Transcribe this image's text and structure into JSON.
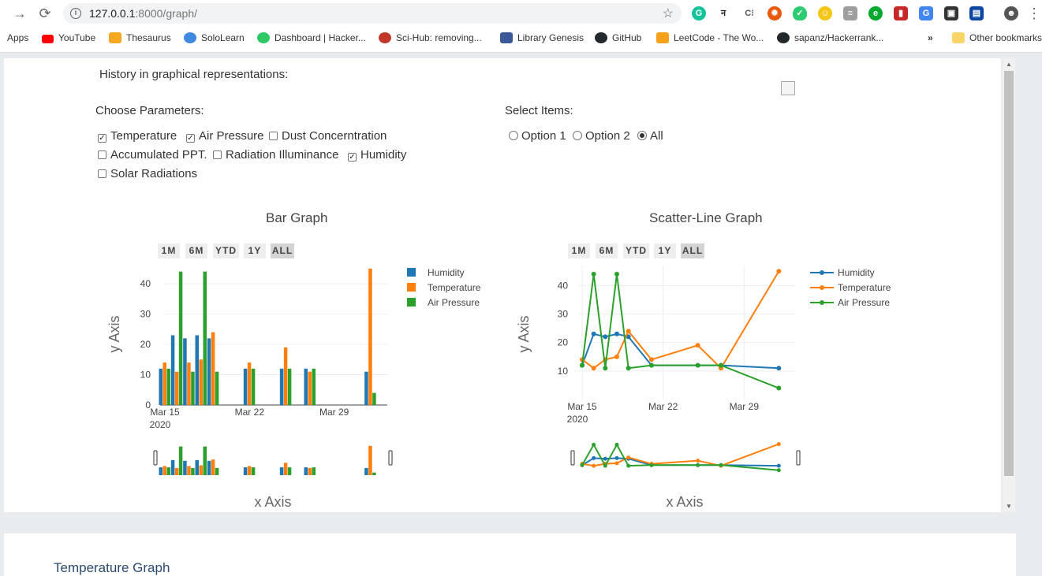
{
  "browser": {
    "url_host": "127.0.0.1",
    "url_path": ":8000/graph/",
    "bookmarks": [
      {
        "label": "Apps",
        "color": "#4285f4"
      },
      {
        "label": "YouTube",
        "color": "#ff0000"
      },
      {
        "label": "Thesaurus",
        "color": "#f6a821"
      },
      {
        "label": "SoloLearn",
        "color": "#3f8ae0"
      },
      {
        "label": "Dashboard | Hacker...",
        "color": "#2ec866"
      },
      {
        "label": "Sci-Hub: removing...",
        "color": "#c0392b"
      },
      {
        "label": "Library Genesis",
        "color": "#3b5998"
      },
      {
        "label": "GitHub",
        "color": "#24292e"
      },
      {
        "label": "LeetCode - The Wo...",
        "color": "#f89f1b"
      },
      {
        "label": "sapanz/Hackerrank...",
        "color": "#24292e"
      }
    ],
    "overflow": "»",
    "other_bookmarks": "Other bookmarks"
  },
  "page": {
    "heading": "History in graphical representations:",
    "params_label": "Choose Parameters:",
    "items_label": "Select Items:",
    "params": [
      {
        "label": "Temperature",
        "checked": true
      },
      {
        "label": "Air Pressure",
        "checked": true
      },
      {
        "label": "Dust Concerntration",
        "checked": false
      },
      {
        "label": "Accumulated PPT.",
        "checked": false
      },
      {
        "label": "Radiation Illuminance",
        "checked": false
      },
      {
        "label": "Humidity",
        "checked": true
      },
      {
        "label": "Solar Radiations",
        "checked": false
      }
    ],
    "items": [
      {
        "label": "Option 1",
        "selected": false
      },
      {
        "label": "Option 2",
        "selected": false
      },
      {
        "label": "All",
        "selected": true
      }
    ],
    "next_section": "Temperature Graph"
  },
  "range_buttons": [
    "1M",
    "6M",
    "YTD",
    "1Y",
    "ALL"
  ],
  "chart_data": [
    {
      "type": "bar",
      "title": "Bar Graph",
      "xlabel": "x Axis",
      "ylabel": "y Axis",
      "x_ticks": [
        "Mar 15\n2020",
        "Mar 22",
        "Mar 29"
      ],
      "y_ticks": [
        0,
        10,
        20,
        30,
        40
      ],
      "ylim": [
        0,
        46
      ],
      "legend": "top-right",
      "dates": [
        "2020-03-15",
        "2020-03-16",
        "2020-03-17",
        "2020-03-18",
        "2020-03-19",
        "2020-03-22",
        "2020-03-25",
        "2020-03-27",
        "2020-04-01"
      ],
      "series": [
        {
          "name": "Humidity",
          "color": "#1f77b4",
          "values": [
            12,
            23,
            22,
            23,
            22,
            12,
            12,
            12,
            11
          ]
        },
        {
          "name": "Temperature",
          "color": "#ff7f0e",
          "values": [
            14,
            11,
            14,
            15,
            24,
            14,
            19,
            11,
            45
          ]
        },
        {
          "name": "Air Pressure",
          "color": "#2ca02c",
          "values": [
            12,
            44,
            11,
            44,
            11,
            12,
            12,
            12,
            4
          ]
        }
      ]
    },
    {
      "type": "line",
      "title": "Scatter-Line Graph",
      "xlabel": "x Axis",
      "ylabel": "y Axis",
      "x_ticks": [
        "Mar 15\n2020",
        "Mar 22",
        "Mar 29"
      ],
      "y_ticks": [
        10,
        20,
        30,
        40
      ],
      "ylim": [
        0,
        47
      ],
      "legend": "top-right",
      "dates": [
        "2020-03-15",
        "2020-03-16",
        "2020-03-17",
        "2020-03-18",
        "2020-03-19",
        "2020-03-21",
        "2020-03-25",
        "2020-03-27",
        "2020-04-01"
      ],
      "series": [
        {
          "name": "Humidity",
          "color": "#1f77b4",
          "values": [
            12,
            23,
            22,
            23,
            22,
            12,
            12,
            12,
            11
          ]
        },
        {
          "name": "Temperature",
          "color": "#ff7f0e",
          "values": [
            14,
            11,
            14,
            15,
            24,
            14,
            19,
            11,
            45
          ]
        },
        {
          "name": "Air Pressure",
          "color": "#2ca02c",
          "values": [
            12,
            44,
            11,
            44,
            11,
            12,
            12,
            12,
            4
          ]
        }
      ]
    }
  ]
}
